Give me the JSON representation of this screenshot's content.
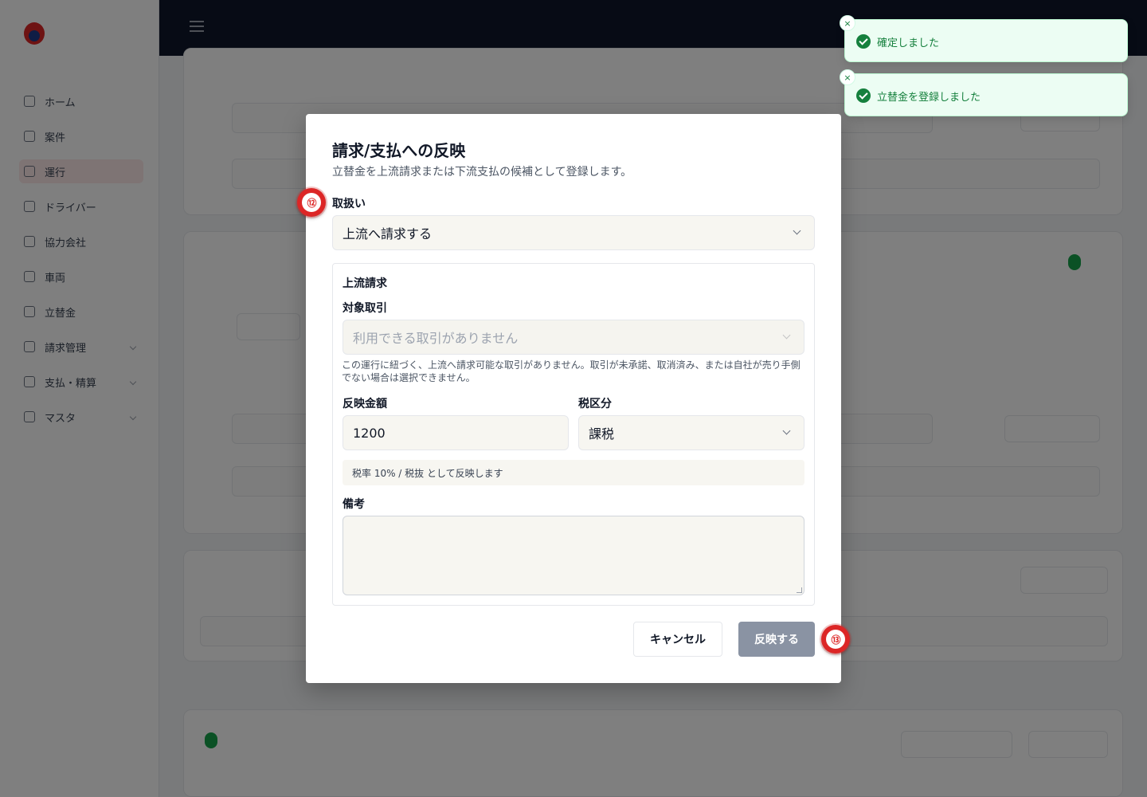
{
  "background": {
    "sidebar_items": [
      {
        "label": "ホーム"
      },
      {
        "label": "案件"
      },
      {
        "label": "運行"
      },
      {
        "label": "ドライバー"
      },
      {
        "label": "協力会社"
      },
      {
        "label": "車両"
      },
      {
        "label": "立替金"
      },
      {
        "label": "請求管理"
      },
      {
        "label": "支払・精算"
      },
      {
        "label": "マスタ"
      }
    ]
  },
  "modal": {
    "title": "請求/支払への反映",
    "description": "立替金を上流請求または下流支払の候補として登録します。",
    "handling_label": "取扱い",
    "handling_value": "上流へ請求する",
    "section_title": "上流請求",
    "target_label": "対象取引",
    "target_placeholder": "利用できる取引がありません",
    "target_help": "この運行に紐づく、上流へ請求可能な取引がありません。取引が未承諾、取消済み、または自社が売り手側でない場合は選択できません。",
    "amount_label": "反映金額",
    "amount_value": "1200",
    "tax_label": "税区分",
    "tax_value": "課税",
    "tax_info": "税率 10% / 税抜 として反映します",
    "note_label": "備考",
    "note_value": "",
    "cancel_label": "キャンセル",
    "apply_label": "反映する"
  },
  "markers": [
    {
      "label": "⑫"
    },
    {
      "label": "⑬"
    }
  ],
  "toasts": [
    {
      "message": "確定しました",
      "close": "×"
    },
    {
      "message": "立替金を登録しました",
      "close": "×"
    }
  ]
}
